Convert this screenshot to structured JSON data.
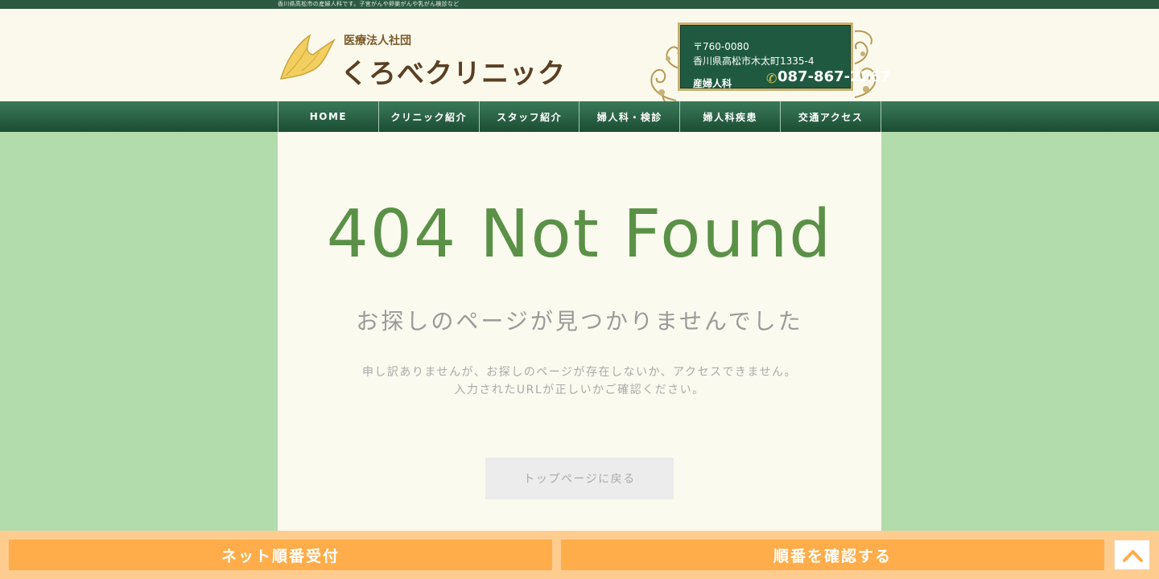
{
  "topbar": {
    "text": "香川県高松市の産婦人科です。子宮がんや卵巣がんや乳がん検診など"
  },
  "logo": {
    "sub": "医療法人社団",
    "name": "くろべクリニック",
    "icon": "leaf-logo-icon"
  },
  "contact": {
    "zip": "〒760-0080",
    "address": "香川県高松市木太町1335-4",
    "department": "産婦人科",
    "phone_icon": "phone-icon",
    "phone": "087-867-2267"
  },
  "nav": {
    "items": [
      {
        "label": "HOME"
      },
      {
        "label": "クリニック紹介"
      },
      {
        "label": "スタッフ紹介"
      },
      {
        "label": "婦人科・検診"
      },
      {
        "label": "婦人科疾患"
      },
      {
        "label": "交通アクセス"
      }
    ]
  },
  "error": {
    "title": "404 Not Found",
    "subtitle": "お探しのページが見つかりませんでした",
    "message_line1": "申し訳ありませんが、お探しのページが存在しないか、アクセスできません。",
    "message_line2": "入力されたURLが正しいかご確認ください。",
    "back_button": "トップページに戻る"
  },
  "footer": {
    "left_button": "ネット順番受付",
    "right_button": "順番を確認する",
    "to_top_icon": "chevron-up-icon"
  },
  "colors": {
    "page_bg": "#b3dcac",
    "header_bg": "#fbf9ec",
    "nav_green": "#1c4d34",
    "title_green": "#5a9147",
    "footer_bg": "#ffcc8f",
    "footer_button": "#ffad4a"
  }
}
